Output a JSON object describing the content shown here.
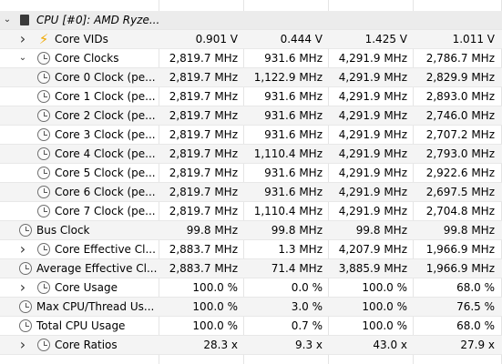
{
  "sensor_table": {
    "group_name": "CPU [#0]: AMD Ryze...",
    "rows": [
      {
        "name": "Core VIDs",
        "icon": "bolt-icon",
        "expander": "collapsed",
        "level": 1,
        "values": [
          "0.901 V",
          "0.444 V",
          "1.425 V",
          "1.011 V"
        ]
      },
      {
        "name": "Core Clocks",
        "icon": "clock-icon",
        "expander": "expanded",
        "level": 1,
        "values": [
          "2,819.7 MHz",
          "931.6 MHz",
          "4,291.9 MHz",
          "2,786.7 MHz"
        ]
      },
      {
        "name": "Core 0 Clock (pe...",
        "icon": "clock-icon",
        "expander": "none",
        "level": 2,
        "values": [
          "2,819.7 MHz",
          "1,122.9 MHz",
          "4,291.9 MHz",
          "2,829.9 MHz"
        ]
      },
      {
        "name": "Core 1 Clock (pe...",
        "icon": "clock-icon",
        "expander": "none",
        "level": 2,
        "values": [
          "2,819.7 MHz",
          "931.6 MHz",
          "4,291.9 MHz",
          "2,893.0 MHz"
        ]
      },
      {
        "name": "Core 2 Clock (pe...",
        "icon": "clock-icon",
        "expander": "none",
        "level": 2,
        "values": [
          "2,819.7 MHz",
          "931.6 MHz",
          "4,291.9 MHz",
          "2,746.0 MHz"
        ]
      },
      {
        "name": "Core 3 Clock (pe...",
        "icon": "clock-icon",
        "expander": "none",
        "level": 2,
        "values": [
          "2,819.7 MHz",
          "931.6 MHz",
          "4,291.9 MHz",
          "2,707.2 MHz"
        ]
      },
      {
        "name": "Core 4 Clock (pe...",
        "icon": "clock-icon",
        "expander": "none",
        "level": 2,
        "values": [
          "2,819.7 MHz",
          "1,110.4 MHz",
          "4,291.9 MHz",
          "2,793.0 MHz"
        ]
      },
      {
        "name": "Core 5 Clock (pe...",
        "icon": "clock-icon",
        "expander": "none",
        "level": 2,
        "values": [
          "2,819.7 MHz",
          "931.6 MHz",
          "4,291.9 MHz",
          "2,922.6 MHz"
        ]
      },
      {
        "name": "Core 6 Clock (pe...",
        "icon": "clock-icon",
        "expander": "none",
        "level": 2,
        "values": [
          "2,819.7 MHz",
          "931.6 MHz",
          "4,291.9 MHz",
          "2,697.5 MHz"
        ]
      },
      {
        "name": "Core 7 Clock (pe...",
        "icon": "clock-icon",
        "expander": "none",
        "level": 2,
        "values": [
          "2,819.7 MHz",
          "1,110.4 MHz",
          "4,291.9 MHz",
          "2,704.8 MHz"
        ]
      },
      {
        "name": "Bus Clock",
        "icon": "clock-icon",
        "expander": "none",
        "level": 0,
        "values": [
          "99.8 MHz",
          "99.8 MHz",
          "99.8 MHz",
          "99.8 MHz"
        ]
      },
      {
        "name": "Core Effective Cl...",
        "icon": "clock-icon",
        "expander": "collapsed",
        "level": 1,
        "values": [
          "2,883.7 MHz",
          "1.3 MHz",
          "4,207.9 MHz",
          "1,966.9 MHz"
        ]
      },
      {
        "name": "Average Effective Cl...",
        "icon": "clock-icon",
        "expander": "none",
        "level": 0,
        "values": [
          "2,883.7 MHz",
          "71.4 MHz",
          "3,885.9 MHz",
          "1,966.9 MHz"
        ]
      },
      {
        "name": "Core Usage",
        "icon": "clock-icon",
        "expander": "collapsed",
        "level": 1,
        "values": [
          "100.0 %",
          "0.0 %",
          "100.0 %",
          "68.0 %"
        ]
      },
      {
        "name": "Max CPU/Thread Us...",
        "icon": "clock-icon",
        "expander": "none",
        "level": 0,
        "values": [
          "100.0 %",
          "3.0 %",
          "100.0 %",
          "76.5 %"
        ]
      },
      {
        "name": "Total CPU Usage",
        "icon": "clock-icon",
        "expander": "none",
        "level": 0,
        "values": [
          "100.0 %",
          "0.7 %",
          "100.0 %",
          "68.0 %"
        ]
      },
      {
        "name": "Core Ratios",
        "icon": "clock-icon",
        "expander": "collapsed",
        "level": 1,
        "values": [
          "28.3 x",
          "9.3 x",
          "43.0 x",
          "27.9 x"
        ]
      }
    ]
  }
}
